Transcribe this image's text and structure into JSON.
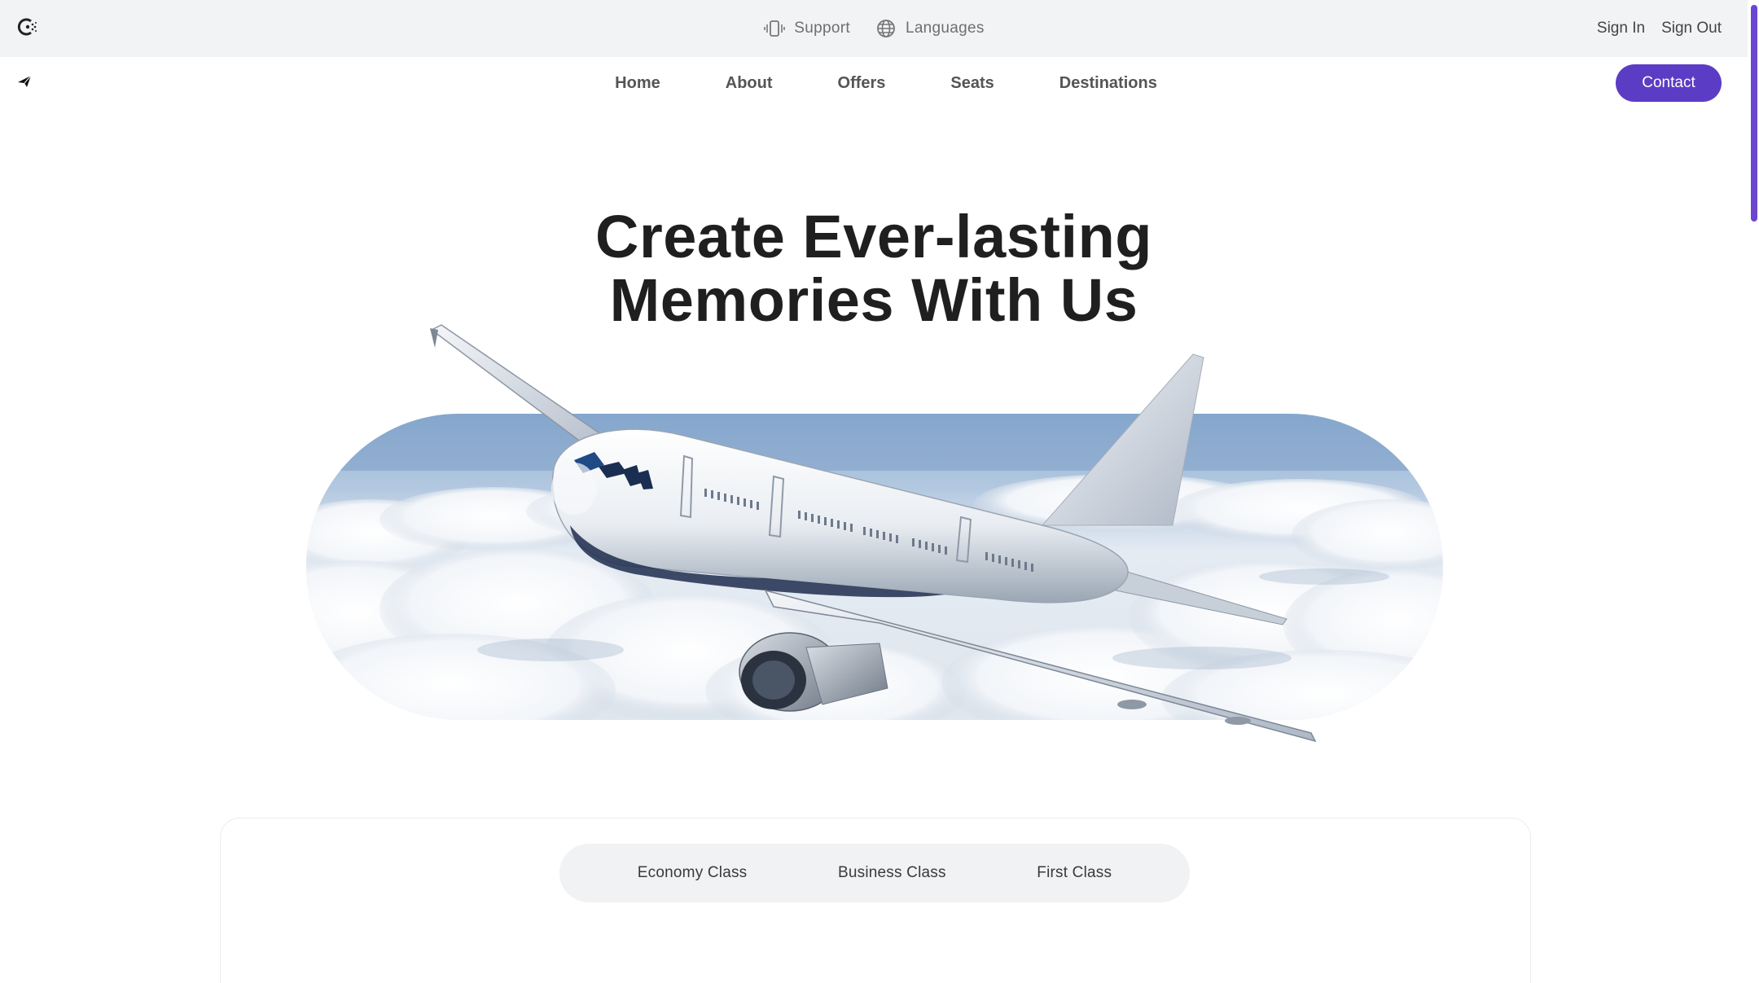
{
  "topbar": {
    "logo_icon": "brand-logo-icon",
    "support_label": "Support",
    "languages_label": "Languages",
    "sign_in_label": "Sign In",
    "sign_out_label": "Sign Out"
  },
  "nav": {
    "items": [
      "Home",
      "About",
      "Offers",
      "Seats",
      "Destinations"
    ],
    "contact_label": "Contact"
  },
  "hero": {
    "title_line1": "Create Ever-lasting",
    "title_line2": "Memories With Us"
  },
  "booking": {
    "tabs": [
      "Economy Class",
      "Business Class",
      "First Class"
    ]
  },
  "colors": {
    "accent": "#5b3cc4",
    "topbar_bg": "#f1f3f4",
    "tab_bg": "#f0f2f3"
  }
}
